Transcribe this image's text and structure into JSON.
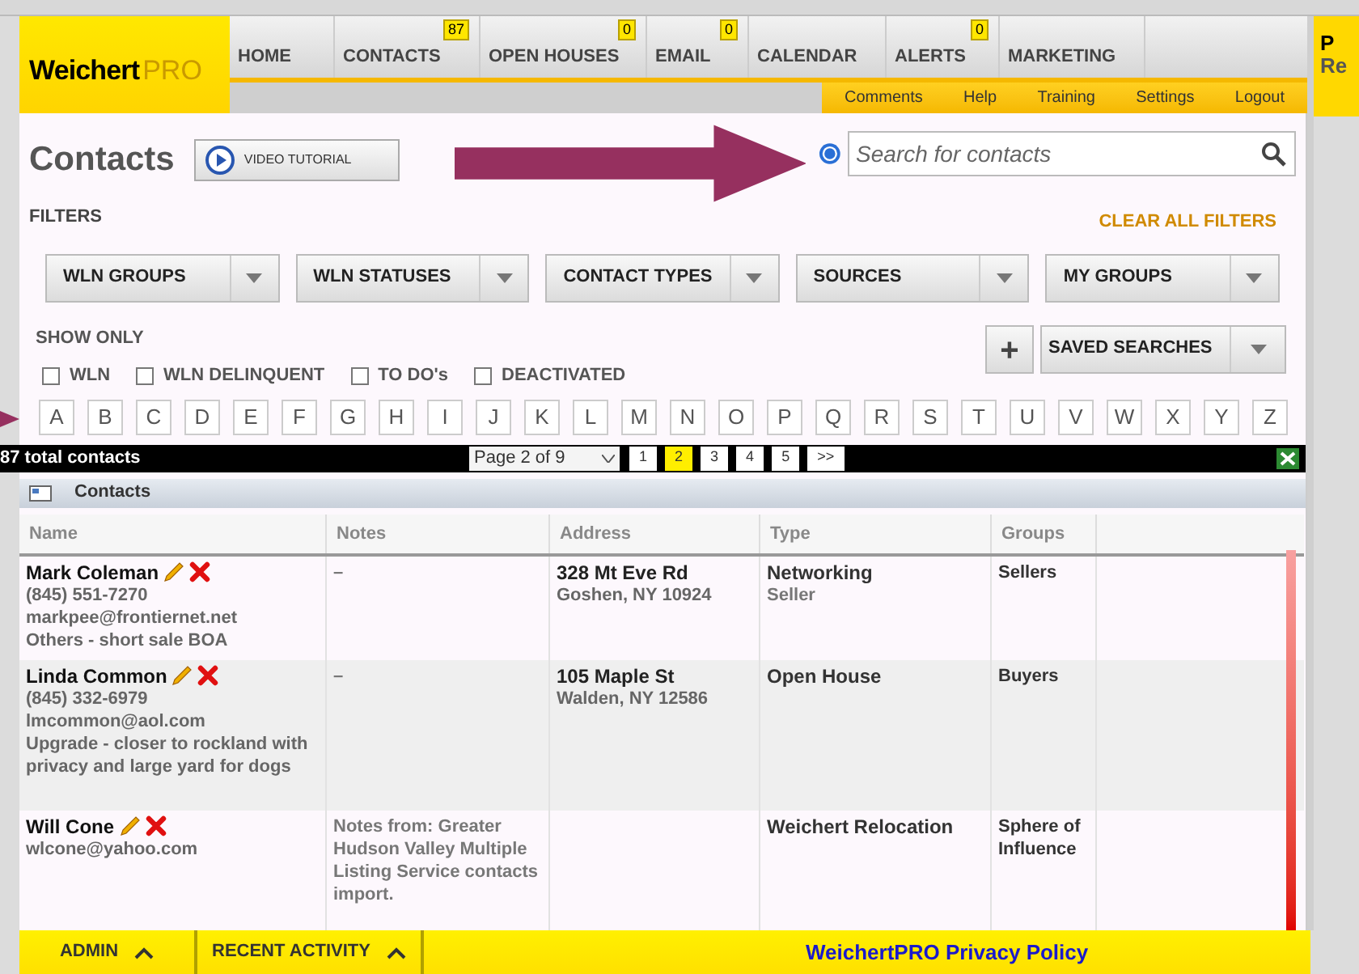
{
  "logo": {
    "brand": "Weichert",
    "suffix": "PRO"
  },
  "nav": [
    {
      "label": "HOME"
    },
    {
      "label": "CONTACTS",
      "badge": "87"
    },
    {
      "label": "OPEN HOUSES",
      "badge": "0"
    },
    {
      "label": "EMAIL",
      "badge": "0"
    },
    {
      "label": "CALENDAR"
    },
    {
      "label": "ALERTS",
      "badge": "0"
    },
    {
      "label": "MARKETING"
    }
  ],
  "sub_links": [
    "Comments",
    "Help",
    "Training",
    "Settings",
    "Logout"
  ],
  "side_panel": {
    "line_1": "P",
    "line_2": "Re"
  },
  "page_title": "Contacts",
  "video_button": "VIDEO TUTORIAL",
  "search": {
    "placeholder": "Search for contacts"
  },
  "filters_label": "FILTERS",
  "clear_filters": "CLEAR ALL FILTERS",
  "filter_dropdowns": [
    "WLN GROUPS",
    "WLN STATUSES",
    "CONTACT TYPES",
    "SOURCES",
    "MY GROUPS"
  ],
  "show_only": {
    "label": "SHOW ONLY",
    "options": [
      {
        "label": "WLN",
        "checked": false
      },
      {
        "label": "WLN DELINQUENT",
        "checked": false
      },
      {
        "label": "TO DO's",
        "checked": false
      },
      {
        "label": "DEACTIVATED",
        "checked": false
      }
    ]
  },
  "add_button": "+",
  "saved_searches": "SAVED SEARCHES",
  "letters": [
    "A",
    "B",
    "C",
    "D",
    "E",
    "F",
    "G",
    "H",
    "I",
    "J",
    "K",
    "L",
    "M",
    "N",
    "O",
    "P",
    "Q",
    "R",
    "S",
    "T",
    "U",
    "V",
    "W",
    "X",
    "Y",
    "Z"
  ],
  "pager": {
    "total": "87 total contacts",
    "page_select": "Page 2 of 9",
    "pages": [
      {
        "label": "1",
        "selected": false
      },
      {
        "label": "2",
        "selected": true
      },
      {
        "label": "3",
        "selected": false
      },
      {
        "label": "4",
        "selected": false
      },
      {
        "label": "5",
        "selected": false
      },
      {
        "label": ">>",
        "selected": false
      }
    ]
  },
  "panel_title": "Contacts",
  "table": {
    "columns": [
      "Name",
      "Notes",
      "Address",
      "Type",
      "Groups"
    ],
    "rows": [
      {
        "name": "Mark Coleman",
        "details": [
          "(845) 551-7270",
          "markpee@frontiernet.net",
          "Others - short sale BOA"
        ],
        "notes": "–",
        "address": "328 Mt Eve Rd",
        "city": "Goshen, NY 10924",
        "type": "Networking",
        "subtype": "Seller",
        "groups": "Sellers"
      },
      {
        "name": "Linda Common",
        "details": [
          "(845) 332-6979",
          "lmcommon@aol.com",
          "Upgrade - closer to rockland with privacy and large yard for dogs"
        ],
        "notes": "–",
        "address": "105 Maple St",
        "city": "Walden, NY 12586",
        "type": "Open House",
        "groups": "Buyers"
      },
      {
        "name": "Will Cone",
        "details": [
          "wlcone@yahoo.com"
        ],
        "notes": "Notes from: Greater Hudson Valley Multiple Listing Service contacts import.",
        "type": "Weichert Relocation",
        "groups": "Sphere of Influence"
      }
    ]
  },
  "footer": {
    "tabs": [
      "ADMIN",
      "RECENT ACTIVITY"
    ],
    "link": "WeichertPRO Privacy Policy"
  }
}
